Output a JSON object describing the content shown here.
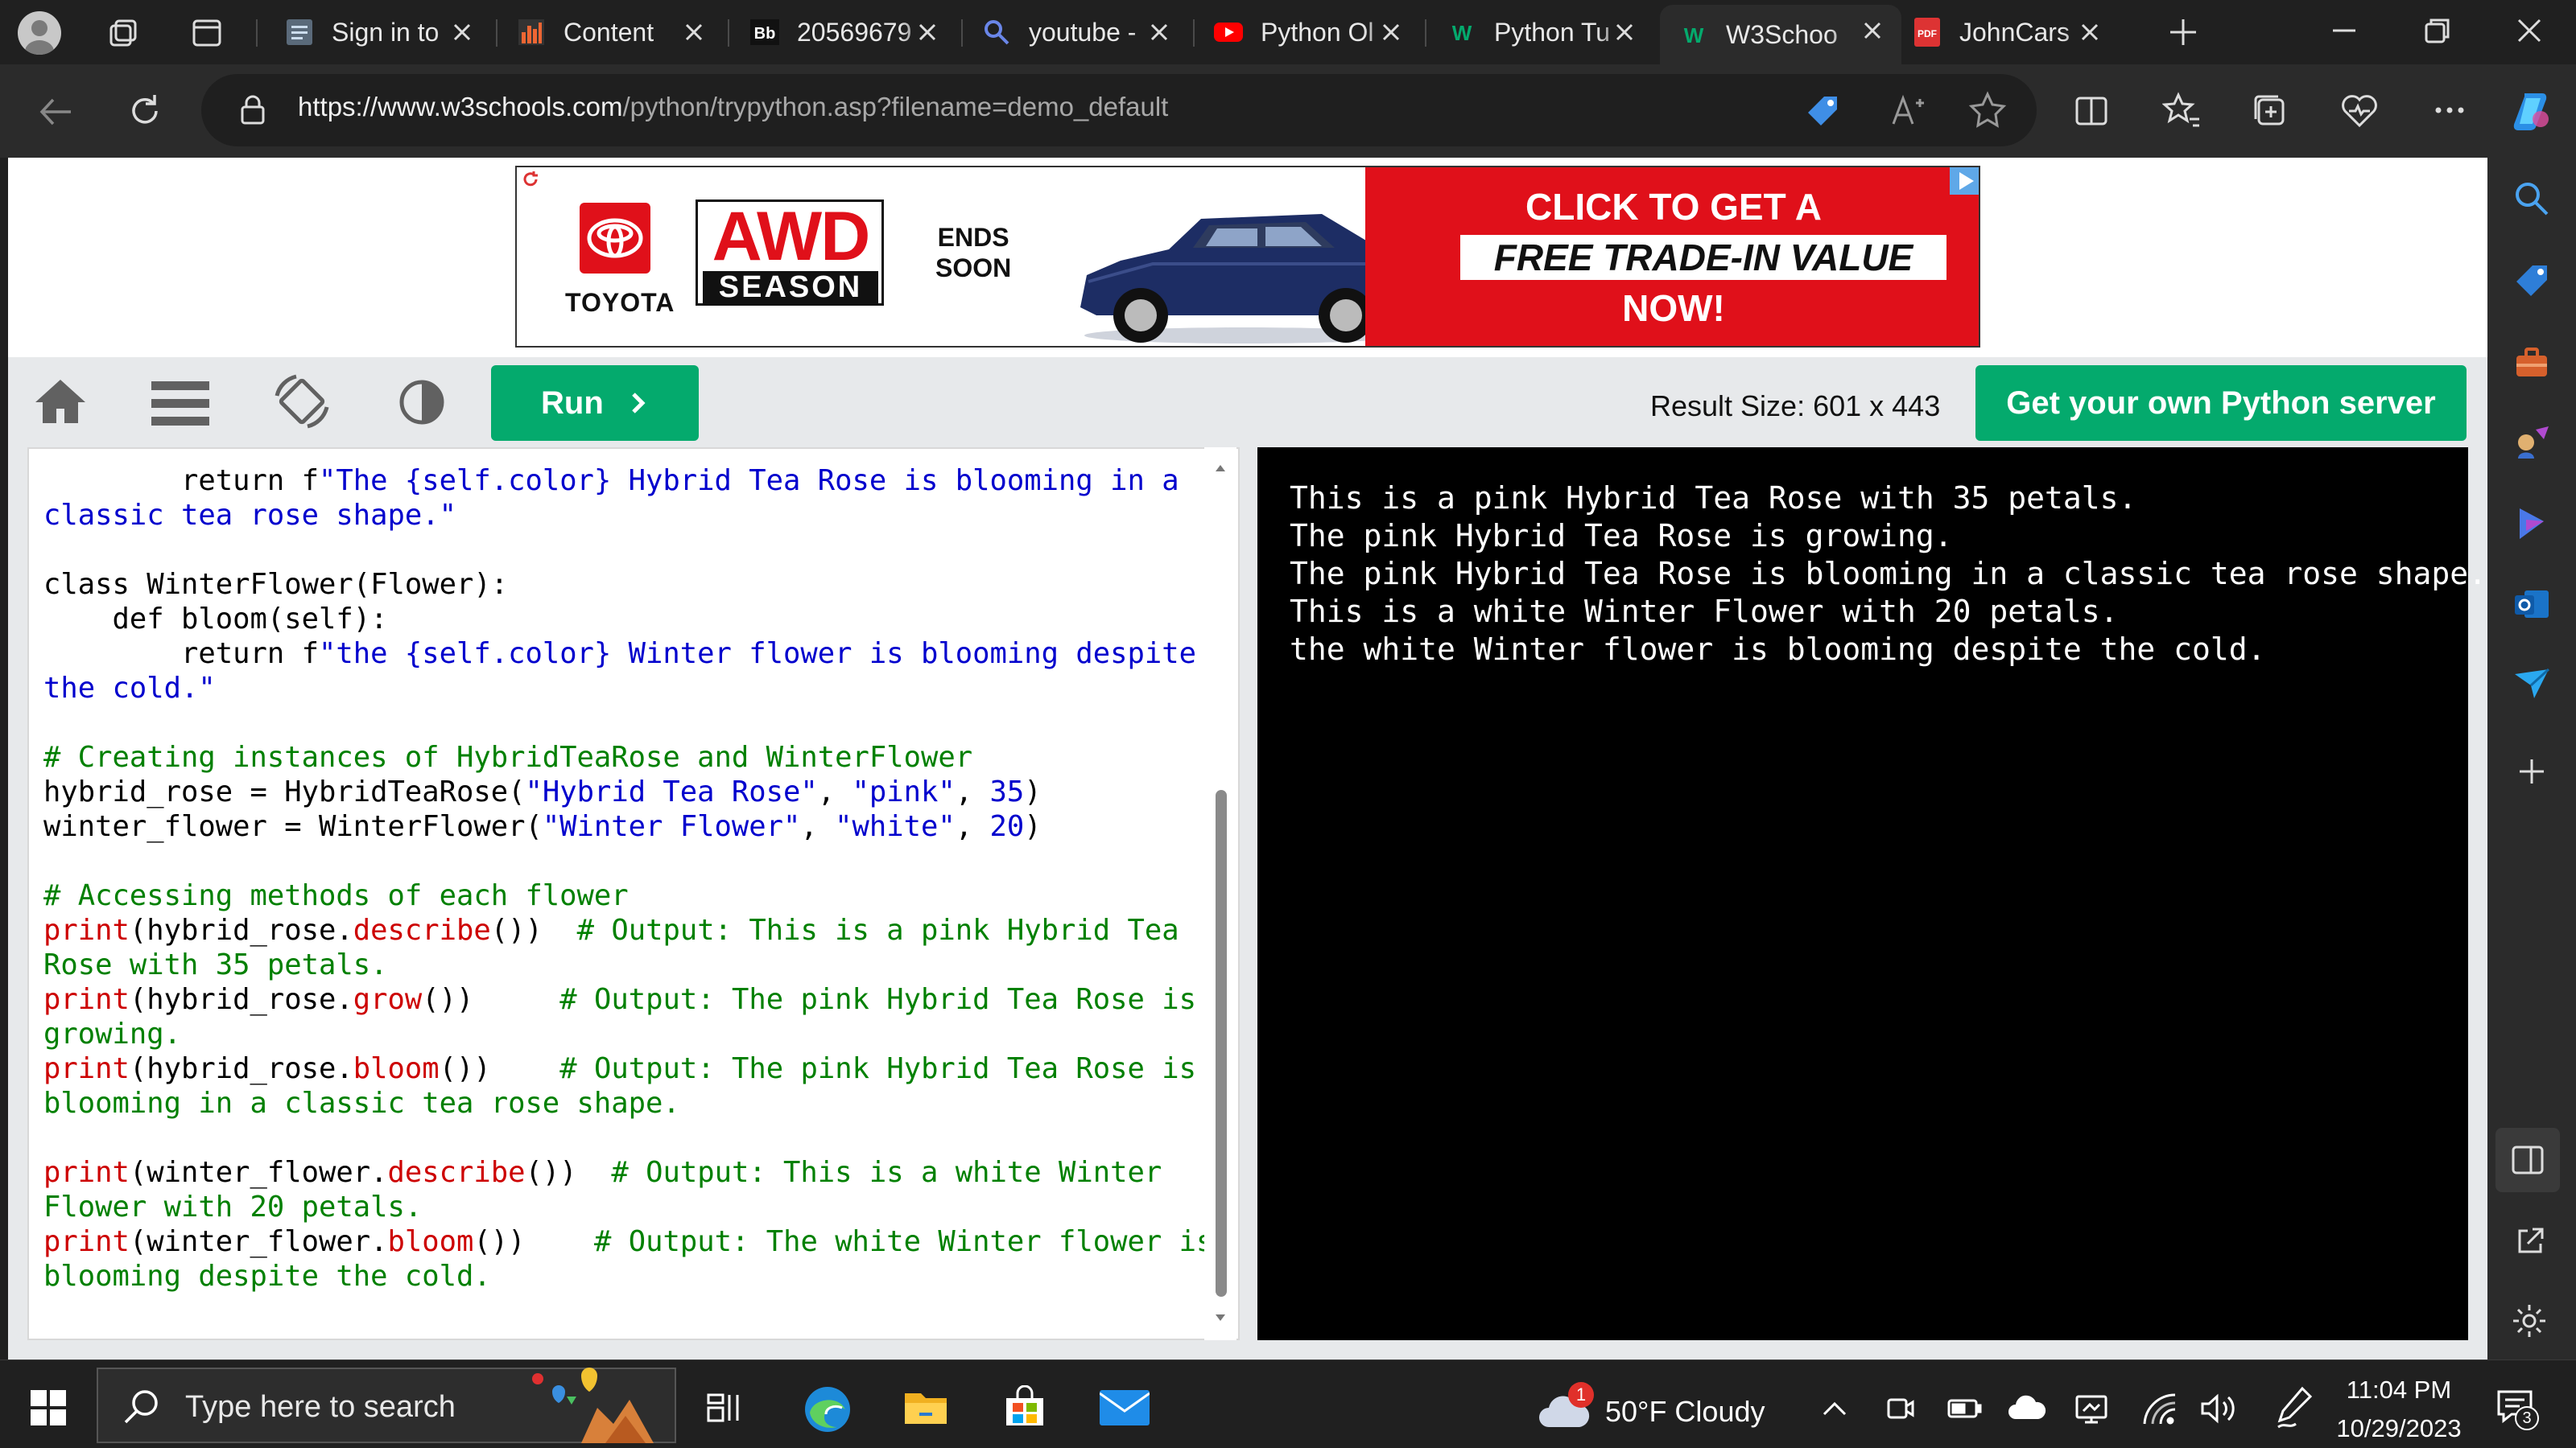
{
  "browser": {
    "tabs": [
      {
        "label": "Sign in to",
        "icon": "page-icon"
      },
      {
        "label": "Content",
        "icon": "bar-chart-icon"
      },
      {
        "label": "20569679",
        "icon": "blackboard-icon"
      },
      {
        "label": "youtube -",
        "icon": "search-icon"
      },
      {
        "label": "Python Ol",
        "icon": "youtube-icon"
      },
      {
        "label": "Python Tu",
        "icon": "w3schools-icon"
      },
      {
        "label": "W3Schoo",
        "icon": "w3schools-icon"
      },
      {
        "label": "JohnCars",
        "icon": "pdf-icon"
      }
    ],
    "active_tab_index": 6,
    "url_host": "https://www.w3schools.com",
    "url_path": "/python/trypython.asp?filename=demo_default",
    "accent": "#04aa6d"
  },
  "ad": {
    "brand": "TOYOTA",
    "badge_top": "AWD",
    "badge_bottom": "SEASON",
    "ends_line1": "ENDS",
    "ends_line2": "SOON",
    "cta_line1": "CLICK TO GET A",
    "cta_line2": "FREE TRADE-IN VALUE",
    "cta_line3": "NOW!"
  },
  "toolbar": {
    "run_label": "Run",
    "result_size": "Result Size: 601 x 443",
    "server_label": "Get your own Python server"
  },
  "editor": {
    "lines": [
      [
        {
          "t": "        return f",
          "c": ""
        },
        {
          "t": "\"The {self.color} Hybrid Tea Rose is blooming in a",
          "c": "str"
        }
      ],
      [
        {
          "t": "classic tea rose shape.\"",
          "c": "str"
        }
      ],
      [
        {
          "t": "",
          "c": ""
        }
      ],
      [
        {
          "t": "class WinterFlower(Flower):",
          "c": ""
        }
      ],
      [
        {
          "t": "    def bloom(self):",
          "c": ""
        }
      ],
      [
        {
          "t": "        return f",
          "c": ""
        },
        {
          "t": "\"the {self.color} Winter flower is blooming despite",
          "c": "str"
        }
      ],
      [
        {
          "t": "the cold.\"",
          "c": "str"
        }
      ],
      [
        {
          "t": "",
          "c": ""
        }
      ],
      [
        {
          "t": "# Creating instances of HybridTeaRose and WinterFlower",
          "c": "cm"
        }
      ],
      [
        {
          "t": "hybrid_rose = HybridTeaRose(",
          "c": ""
        },
        {
          "t": "\"Hybrid Tea Rose\"",
          "c": "str"
        },
        {
          "t": ", ",
          "c": ""
        },
        {
          "t": "\"pink\"",
          "c": "str"
        },
        {
          "t": ", ",
          "c": ""
        },
        {
          "t": "35",
          "c": "str"
        },
        {
          "t": ")",
          "c": ""
        }
      ],
      [
        {
          "t": "winter_flower = WinterFlower(",
          "c": ""
        },
        {
          "t": "\"Winter Flower\"",
          "c": "str"
        },
        {
          "t": ", ",
          "c": ""
        },
        {
          "t": "\"white\"",
          "c": "str"
        },
        {
          "t": ", ",
          "c": ""
        },
        {
          "t": "20",
          "c": "str"
        },
        {
          "t": ")",
          "c": ""
        }
      ],
      [
        {
          "t": "",
          "c": ""
        }
      ],
      [
        {
          "t": "# Accessing methods of each flower",
          "c": "cm"
        }
      ],
      [
        {
          "t": "print",
          "c": "m"
        },
        {
          "t": "(hybrid_rose.",
          "c": ""
        },
        {
          "t": "describe",
          "c": "m"
        },
        {
          "t": "())  ",
          "c": ""
        },
        {
          "t": "# Output: This is a pink Hybrid Tea",
          "c": "cm"
        }
      ],
      [
        {
          "t": "Rose with 35 petals.",
          "c": "cm"
        }
      ],
      [
        {
          "t": "print",
          "c": "m"
        },
        {
          "t": "(hybrid_rose.",
          "c": ""
        },
        {
          "t": "grow",
          "c": "m"
        },
        {
          "t": "())     ",
          "c": ""
        },
        {
          "t": "# Output: The pink Hybrid Tea Rose is",
          "c": "cm"
        }
      ],
      [
        {
          "t": "growing.",
          "c": "cm"
        }
      ],
      [
        {
          "t": "print",
          "c": "m"
        },
        {
          "t": "(hybrid_rose.",
          "c": ""
        },
        {
          "t": "bloom",
          "c": "m"
        },
        {
          "t": "())    ",
          "c": ""
        },
        {
          "t": "# Output: The pink Hybrid Tea Rose is",
          "c": "cm"
        }
      ],
      [
        {
          "t": "blooming in a classic tea rose shape.",
          "c": "cm"
        }
      ],
      [
        {
          "t": "",
          "c": ""
        }
      ],
      [
        {
          "t": "print",
          "c": "m"
        },
        {
          "t": "(winter_flower.",
          "c": ""
        },
        {
          "t": "describe",
          "c": "m"
        },
        {
          "t": "())  ",
          "c": ""
        },
        {
          "t": "# Output: This is a white Winter",
          "c": "cm"
        }
      ],
      [
        {
          "t": "Flower with 20 petals.",
          "c": "cm"
        }
      ],
      [
        {
          "t": "print",
          "c": "m"
        },
        {
          "t": "(winter_flower.",
          "c": ""
        },
        {
          "t": "bloom",
          "c": "m"
        },
        {
          "t": "())    ",
          "c": ""
        },
        {
          "t": "# Output: The white Winter flower is",
          "c": "cm"
        }
      ],
      [
        {
          "t": "blooming despite the cold.",
          "c": "cm"
        }
      ]
    ]
  },
  "result": {
    "lines": [
      "This is a pink Hybrid Tea Rose with 35 petals.",
      "The pink Hybrid Tea Rose is growing.",
      "The pink Hybrid Tea Rose is blooming in a classic tea rose shape.",
      "This is a white Winter Flower with 20 petals.",
      "the white Winter flower is blooming despite the cold."
    ]
  },
  "taskbar": {
    "search_placeholder": "Type here to search",
    "weather": "50°F  Cloudy",
    "weather_badge": "1",
    "time": "11:04 PM",
    "date": "10/29/2023",
    "notifications": "3"
  }
}
